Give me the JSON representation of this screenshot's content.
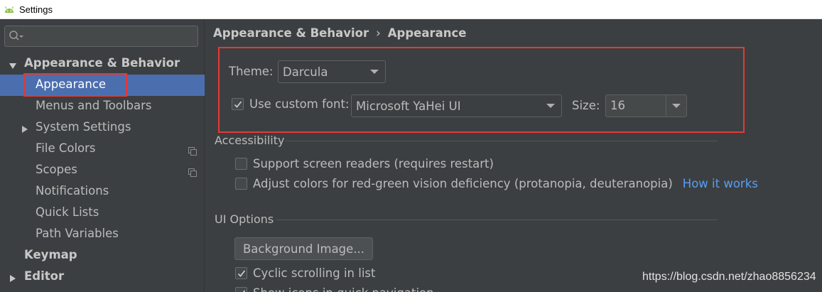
{
  "window": {
    "title": "Settings",
    "icon": "android-icon"
  },
  "sidebar": {
    "search": {
      "placeholder": "",
      "value": "",
      "icon": "search-icon"
    },
    "items": [
      {
        "label": "Appearance & Behavior",
        "level": 0,
        "bold": true,
        "expanded": true
      },
      {
        "label": "Appearance",
        "level": 1,
        "selected": true
      },
      {
        "label": "Menus and Toolbars",
        "level": 1
      },
      {
        "label": "System Settings",
        "level": 1,
        "collapsed": true
      },
      {
        "label": "File Colors",
        "level": 1,
        "icon": "copy-icon"
      },
      {
        "label": "Scopes",
        "level": 1,
        "icon": "copy-icon"
      },
      {
        "label": "Notifications",
        "level": 1
      },
      {
        "label": "Quick Lists",
        "level": 1
      },
      {
        "label": "Path Variables",
        "level": 1
      },
      {
        "label": "Keymap",
        "level": 0,
        "bold": true
      },
      {
        "label": "Editor",
        "level": 0,
        "bold": true,
        "collapsed": true
      }
    ]
  },
  "main": {
    "breadcrumb": [
      "Appearance & Behavior",
      "Appearance"
    ],
    "breadcrumb_separator": "›",
    "theme": {
      "label": "Theme:",
      "value": "Darcula"
    },
    "custom_font": {
      "label": "Use custom font:",
      "checked": true,
      "value": "Microsoft YaHei UI"
    },
    "size": {
      "label": "Size:",
      "value": "16"
    },
    "accessibility": {
      "title": "Accessibility",
      "screen_readers": {
        "label": "Support screen readers (requires restart)",
        "checked": false
      },
      "color_deficiency": {
        "label": "Adjust colors for red-green vision deficiency (protanopia, deuteranopia)",
        "checked": false
      },
      "how_it_works": "How it works"
    },
    "ui_options": {
      "title": "UI Options",
      "background_image_button": "Background Image...",
      "cyclic_scrolling": {
        "label": "Cyclic scrolling in list",
        "checked": true
      },
      "show_icons": {
        "label": "Show icons in quick navigation",
        "checked": true
      }
    }
  },
  "watermark": "https://blog.csdn.net/zhao8856234",
  "colors": {
    "background": "#3c3f41",
    "selection": "#4b6eaf",
    "link": "#589df6",
    "annotation_red": "#e53935",
    "text": "#bbbbbb"
  }
}
